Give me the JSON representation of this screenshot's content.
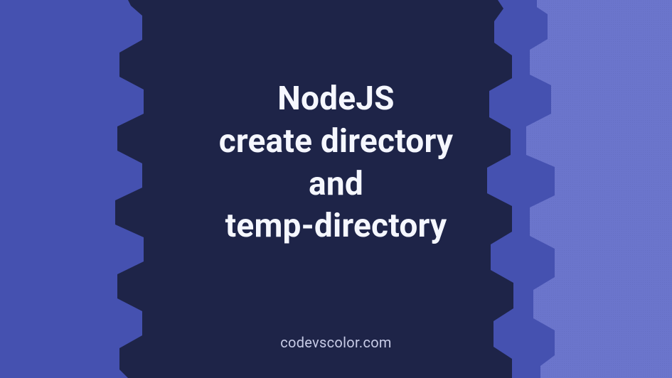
{
  "title": {
    "line1": "NodeJS",
    "line2": "create directory",
    "line3": "and",
    "line4": "temp-directory"
  },
  "site": "codevscolor.com",
  "colors": {
    "outer_light": "#6b75cc",
    "mid_purple": "#4551b0",
    "inner_dark": "#1e2448",
    "text": "#f5f7ff",
    "site_text": "#c7cbe6"
  }
}
